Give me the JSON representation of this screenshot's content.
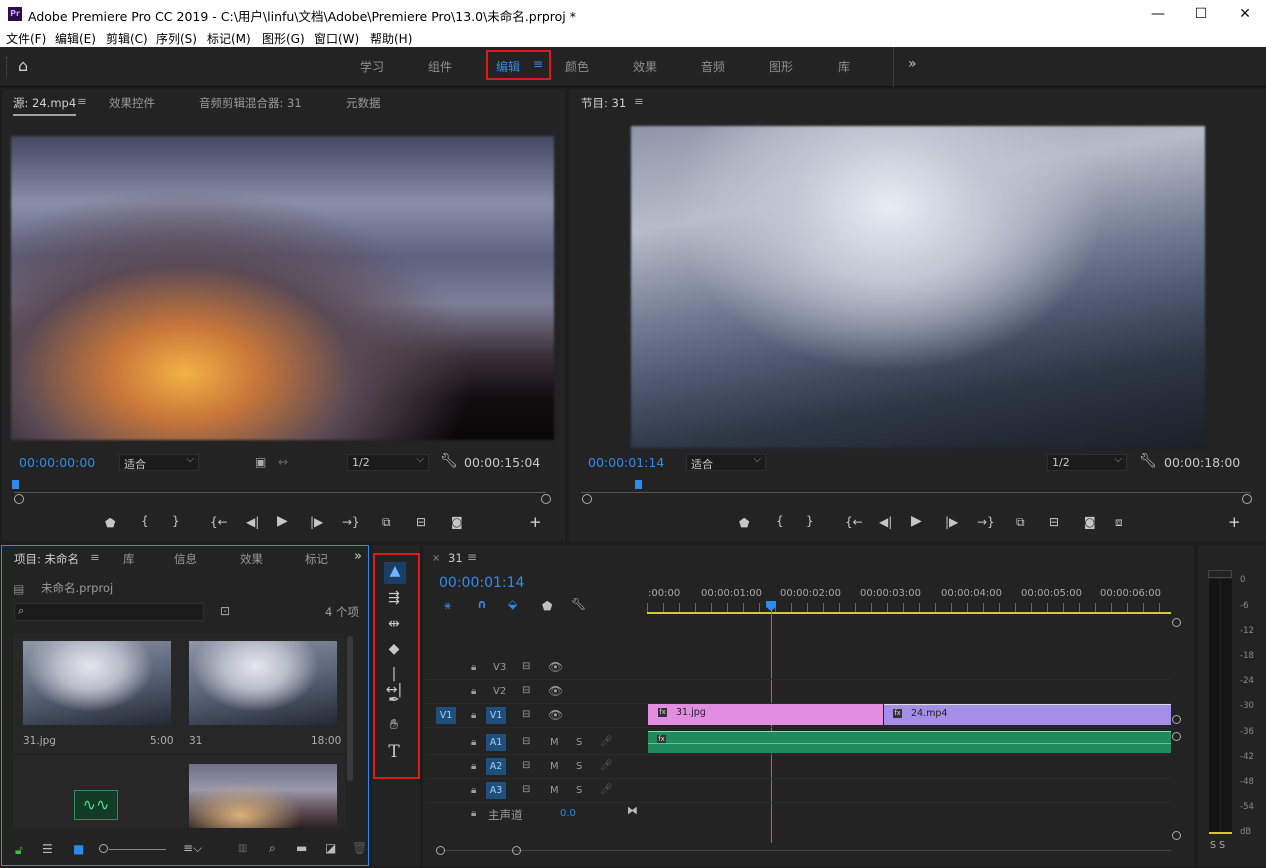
{
  "window": {
    "app_logo": "Pr",
    "title": "Adobe Premiere Pro CC 2019 - C:\\用户\\linfu\\文档\\Adobe\\Premiere Pro\\13.0\\未命名.prproj *",
    "minimize": "—",
    "maximize": "☐",
    "close": "✕"
  },
  "menu": [
    "文件(F)",
    "编辑(E)",
    "剪辑(C)",
    "序列(S)",
    "标记(M)",
    "图形(G)",
    "窗口(W)",
    "帮助(H)"
  ],
  "workspaces": {
    "items": [
      "学习",
      "组件",
      "编辑",
      "颜色",
      "效果",
      "音频",
      "图形",
      "库"
    ],
    "active": "编辑",
    "more": "»"
  },
  "source_panel": {
    "tabs": [
      "源: 24.mp4",
      "效果控件",
      "音频剪辑混合器: 31",
      "元数据"
    ],
    "timecode": "00:00:00:00",
    "fit": "适合",
    "resolution": "1/2",
    "duration": "00:00:15:04"
  },
  "program_panel": {
    "tab": "节目: 31",
    "timecode": "00:00:01:14",
    "fit": "适合",
    "resolution": "1/2",
    "duration": "00:00:18:00"
  },
  "project_panel": {
    "tabs": [
      "项目: 未命名",
      "库",
      "信息",
      "效果",
      "标记"
    ],
    "file": "未命名.prproj",
    "item_count": "4 个项",
    "items": [
      {
        "name": "31.jpg",
        "duration": "5:00"
      },
      {
        "name": "31",
        "duration": "18:00"
      }
    ]
  },
  "timeline": {
    "sequence": "31",
    "timecode": "00:00:01:14",
    "ruler": [
      ":00:00",
      "00:00:01:00",
      "00:00:02:00",
      "00:00:03:00",
      "00:00:04:00",
      "00:00:05:00",
      "00:00:06:00"
    ],
    "tracks_video": [
      "V3",
      "V2",
      "V1"
    ],
    "tracks_audio": [
      "A1",
      "A2",
      "A3"
    ],
    "source_patch": "V1",
    "mute": "M",
    "solo": "S",
    "master": "主声道",
    "master_value": "0.0",
    "clips": {
      "v1_a": "31.jpg",
      "v1_b": "24.mp4"
    }
  },
  "meter": {
    "labels": [
      "0",
      "-6",
      "-12",
      "-18",
      "-24",
      "-30",
      "-36",
      "-42",
      "-48",
      "-54",
      "dB"
    ],
    "solo": "S S"
  },
  "colors": {
    "accent": "#2d8ceb",
    "clip_image": "#e28ee0",
    "clip_video": "#a58ee8",
    "clip_audio": "#1f8a5c",
    "highlight": "#e01a1a"
  }
}
